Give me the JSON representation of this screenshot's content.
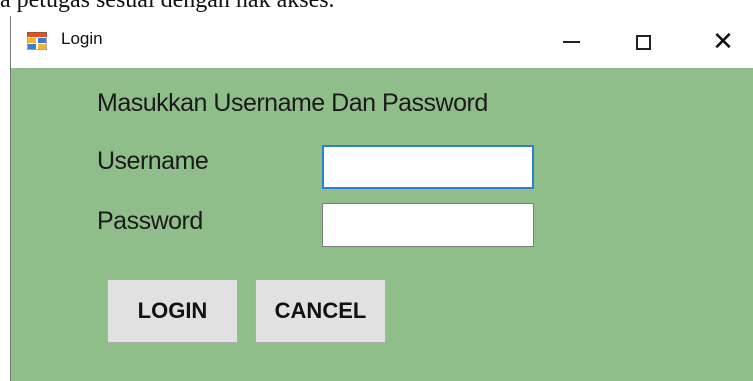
{
  "document": {
    "text_above": "a petugas sesuai dengan hak akses."
  },
  "window": {
    "title": "Login",
    "icon": "form-icon",
    "controls": {
      "minimize": "minimize-icon",
      "maximize": "maximize-icon",
      "close": "close-icon",
      "close_glyph": "✕"
    }
  },
  "form": {
    "heading": "Masukkan Username Dan Password",
    "username_label": "Username",
    "username_value": "",
    "password_label": "Password",
    "password_value": "",
    "login_button": "LOGIN",
    "cancel_button": "CANCEL"
  },
  "colors": {
    "form_background": "#90be8b",
    "titlebar": "#ffffff",
    "focused_border": "#2f7fcf",
    "button_face": "#e1e1e1"
  }
}
